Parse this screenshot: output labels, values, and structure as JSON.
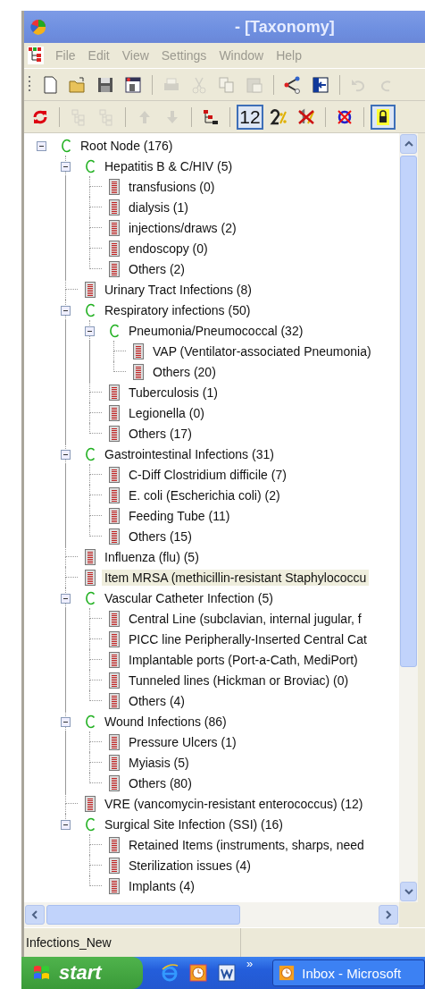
{
  "window": {
    "title": "- [Taxonomy]"
  },
  "menu": [
    "File",
    "Edit",
    "View",
    "Settings",
    "Window",
    "Help"
  ],
  "toolbar_main": [
    {
      "kind": "new",
      "disabled": false
    },
    {
      "kind": "open",
      "disabled": false
    },
    {
      "kind": "save",
      "disabled": false
    },
    {
      "kind": "preview",
      "disabled": false
    },
    {
      "kind": "sep"
    },
    {
      "kind": "print",
      "disabled": true
    },
    {
      "kind": "cut",
      "disabled": true
    },
    {
      "kind": "copy",
      "disabled": true
    },
    {
      "kind": "paste",
      "disabled": true
    },
    {
      "kind": "sep"
    },
    {
      "kind": "graph",
      "disabled": false
    },
    {
      "kind": "panel",
      "disabled": false
    },
    {
      "kind": "sep"
    },
    {
      "kind": "undo",
      "disabled": true
    },
    {
      "kind": "redo",
      "disabled": true
    }
  ],
  "toolbar_tree": [
    {
      "kind": "refresh",
      "pressed": false,
      "disabled": false
    },
    {
      "kind": "sep"
    },
    {
      "kind": "tree-a",
      "pressed": false,
      "disabled": true
    },
    {
      "kind": "tree-b",
      "pressed": false,
      "disabled": true
    },
    {
      "kind": "sep"
    },
    {
      "kind": "up",
      "pressed": false,
      "disabled": true
    },
    {
      "kind": "down",
      "pressed": false,
      "disabled": true
    },
    {
      "kind": "sep"
    },
    {
      "kind": "hierarchy",
      "pressed": false,
      "disabled": false
    },
    {
      "kind": "sep"
    },
    {
      "kind": "text",
      "label": "12",
      "pressed": true,
      "disabled": false
    },
    {
      "kind": "percent",
      "pressed": false,
      "disabled": false
    },
    {
      "kind": "no-percent",
      "pressed": false,
      "disabled": false
    },
    {
      "kind": "sep"
    },
    {
      "kind": "no-circle",
      "pressed": false,
      "disabled": false
    },
    {
      "kind": "sep"
    },
    {
      "kind": "lock",
      "pressed": true,
      "disabled": false
    }
  ],
  "tree": [
    {
      "kind": "category",
      "label": "Root Node (176)",
      "expanded": true,
      "selected": false,
      "children": [
        {
          "kind": "category",
          "label": "Hepatitis B & C/HIV (5)",
          "expanded": true,
          "selected": false,
          "children": [
            {
              "kind": "item",
              "label": "transfusions  (0)",
              "selected": false
            },
            {
              "kind": "item",
              "label": "dialysis  (1)",
              "selected": false
            },
            {
              "kind": "item",
              "label": "injections/draws  (2)",
              "selected": false
            },
            {
              "kind": "item",
              "label": "endoscopy  (0)",
              "selected": false
            },
            {
              "kind": "item",
              "label": "Others (2)",
              "selected": false
            }
          ]
        },
        {
          "kind": "item",
          "label": "Urinary Tract Infections  (8)",
          "selected": false
        },
        {
          "kind": "category",
          "label": "Respiratory infections  (50)",
          "expanded": true,
          "selected": false,
          "children": [
            {
              "kind": "category",
              "label": "Pneumonia/Pneumococcal  (32)",
              "expanded": true,
              "selected": false,
              "children": [
                {
                  "kind": "item",
                  "label": "VAP (Ventilator-associated Pneumonia)",
                  "selected": false
                },
                {
                  "kind": "item",
                  "label": "Others (20)",
                  "selected": false
                }
              ]
            },
            {
              "kind": "item",
              "label": "Tuberculosis  (1)",
              "selected": false
            },
            {
              "kind": "item",
              "label": "Legionella  (0)",
              "selected": false
            },
            {
              "kind": "item",
              "label": "Others (17)",
              "selected": false
            }
          ]
        },
        {
          "kind": "category",
          "label": "Gastrointestinal Infections  (31)",
          "expanded": true,
          "selected": false,
          "children": [
            {
              "kind": "item",
              "label": "C-Diff Clostridium difficile  (7)",
              "selected": false
            },
            {
              "kind": "item",
              "label": "E. coli (Escherichia coli)  (2)",
              "selected": false
            },
            {
              "kind": "item",
              "label": "Feeding Tube (11)",
              "selected": false
            },
            {
              "kind": "item",
              "label": "Others (15)",
              "selected": false
            }
          ]
        },
        {
          "kind": "item",
          "label": "Influenza (flu)  (5)",
          "selected": false
        },
        {
          "kind": "item",
          "label": "Item MRSA (methicillin-resistant Staphylococcu",
          "selected": true
        },
        {
          "kind": "category",
          "label": "Vascular Catheter Infection  (5)",
          "expanded": true,
          "selected": false,
          "children": [
            {
              "kind": "item",
              "label": "Central Line (subclavian, internal jugular, f",
              "selected": false
            },
            {
              "kind": "item",
              "label": "PICC line Peripherally-Inserted Central Cat",
              "selected": false
            },
            {
              "kind": "item",
              "label": "Implantable ports (Port-a-Cath, MediPort)",
              "selected": false
            },
            {
              "kind": "item",
              "label": "Tunneled lines (Hickman or Broviac)  (0)",
              "selected": false
            },
            {
              "kind": "item",
              "label": "Others (4)",
              "selected": false
            }
          ]
        },
        {
          "kind": "category",
          "label": "Wound Infections  (86)",
          "expanded": true,
          "selected": false,
          "children": [
            {
              "kind": "item",
              "label": "Pressure Ulcers  (1)",
              "selected": false
            },
            {
              "kind": "item",
              "label": "Myiasis  (5)",
              "selected": false
            },
            {
              "kind": "item",
              "label": "Others (80)",
              "selected": false
            }
          ]
        },
        {
          "kind": "item",
          "label": "VRE (vancomycin-resistant enterococcus)  (12)",
          "selected": false
        },
        {
          "kind": "category",
          "label": "Surgical Site Infection (SSI)  (16)",
          "expanded": true,
          "selected": false,
          "children": [
            {
              "kind": "item",
              "label": "Retained Items (instruments, sharps, need",
              "selected": false
            },
            {
              "kind": "item",
              "label": "Sterilization issues  (4)",
              "selected": false
            },
            {
              "kind": "item",
              "label": "Implants  (4)",
              "selected": false
            }
          ]
        }
      ]
    }
  ],
  "status_bar": {
    "text": "Infections_New"
  },
  "taskbar": {
    "start": "start",
    "chevron": "»",
    "quick_launch": [
      {
        "kind": "browser"
      },
      {
        "kind": "clock"
      },
      {
        "kind": "word"
      }
    ],
    "tasks": [
      {
        "label": "Inbox - Microsoft",
        "selected": false
      }
    ]
  }
}
